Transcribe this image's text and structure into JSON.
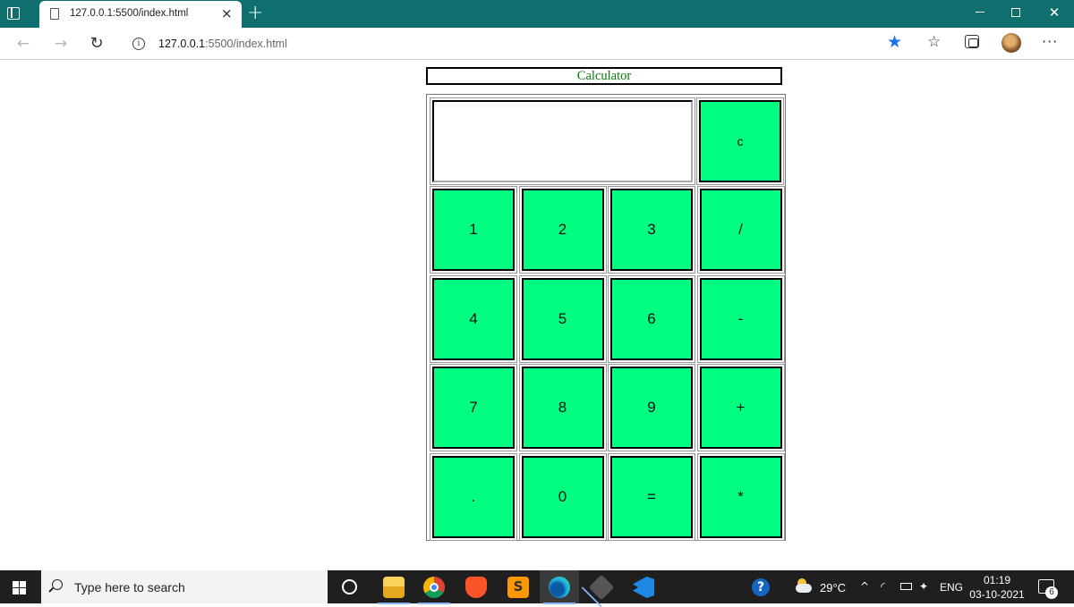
{
  "browser": {
    "tab_title": "127.0.0.1:5500/index.html",
    "tab_close": "×",
    "new_tab": "+",
    "url_host": "127.0.0.1",
    "url_path": ":5500/index.html",
    "nav_back": "←",
    "nav_forward": "→",
    "refresh": "↻",
    "info": "i",
    "favorite_star": "★",
    "favorites": "☆",
    "more": "···",
    "win_close": "✕"
  },
  "calculator": {
    "title": "Calculator",
    "display_value": "",
    "clear_label": "c",
    "keys": [
      [
        "1",
        "2",
        "3",
        "/"
      ],
      [
        "4",
        "5",
        "6",
        "-"
      ],
      [
        "7",
        "8",
        "9",
        "+"
      ],
      [
        ".",
        "0",
        "=",
        "*"
      ]
    ],
    "key_color": "#00ff80",
    "title_color": "#0a7a0a"
  },
  "taskbar": {
    "search_placeholder": "Type here to search",
    "help": "?",
    "temperature": "29°C",
    "chevron": "^",
    "wifi": "◜",
    "dropbox": "✦",
    "language": "ENG",
    "time": "01:19",
    "date": "03-10-2021",
    "notification_count": "6"
  }
}
